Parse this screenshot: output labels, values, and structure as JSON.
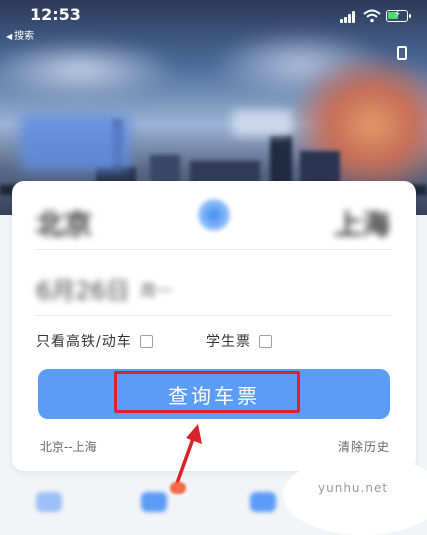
{
  "status_bar": {
    "time": "12:53",
    "back_label": "搜索"
  },
  "route": {
    "from_city": "北京",
    "to_city": "上海",
    "date": "6月26日",
    "weekday": "周一"
  },
  "options": {
    "highspeed_label": "只看高铁/动车",
    "highspeed_checked": false,
    "student_label": "学生票",
    "student_checked": false
  },
  "query_button": {
    "label": "查询车票"
  },
  "history": {
    "recent": "北京--上海",
    "clear_label": "清除历史"
  },
  "watermark": "yunhu.net",
  "colors": {
    "primary": "#5b9cf7",
    "highlight": "#d8232a",
    "card_bg": "#ffffff"
  }
}
